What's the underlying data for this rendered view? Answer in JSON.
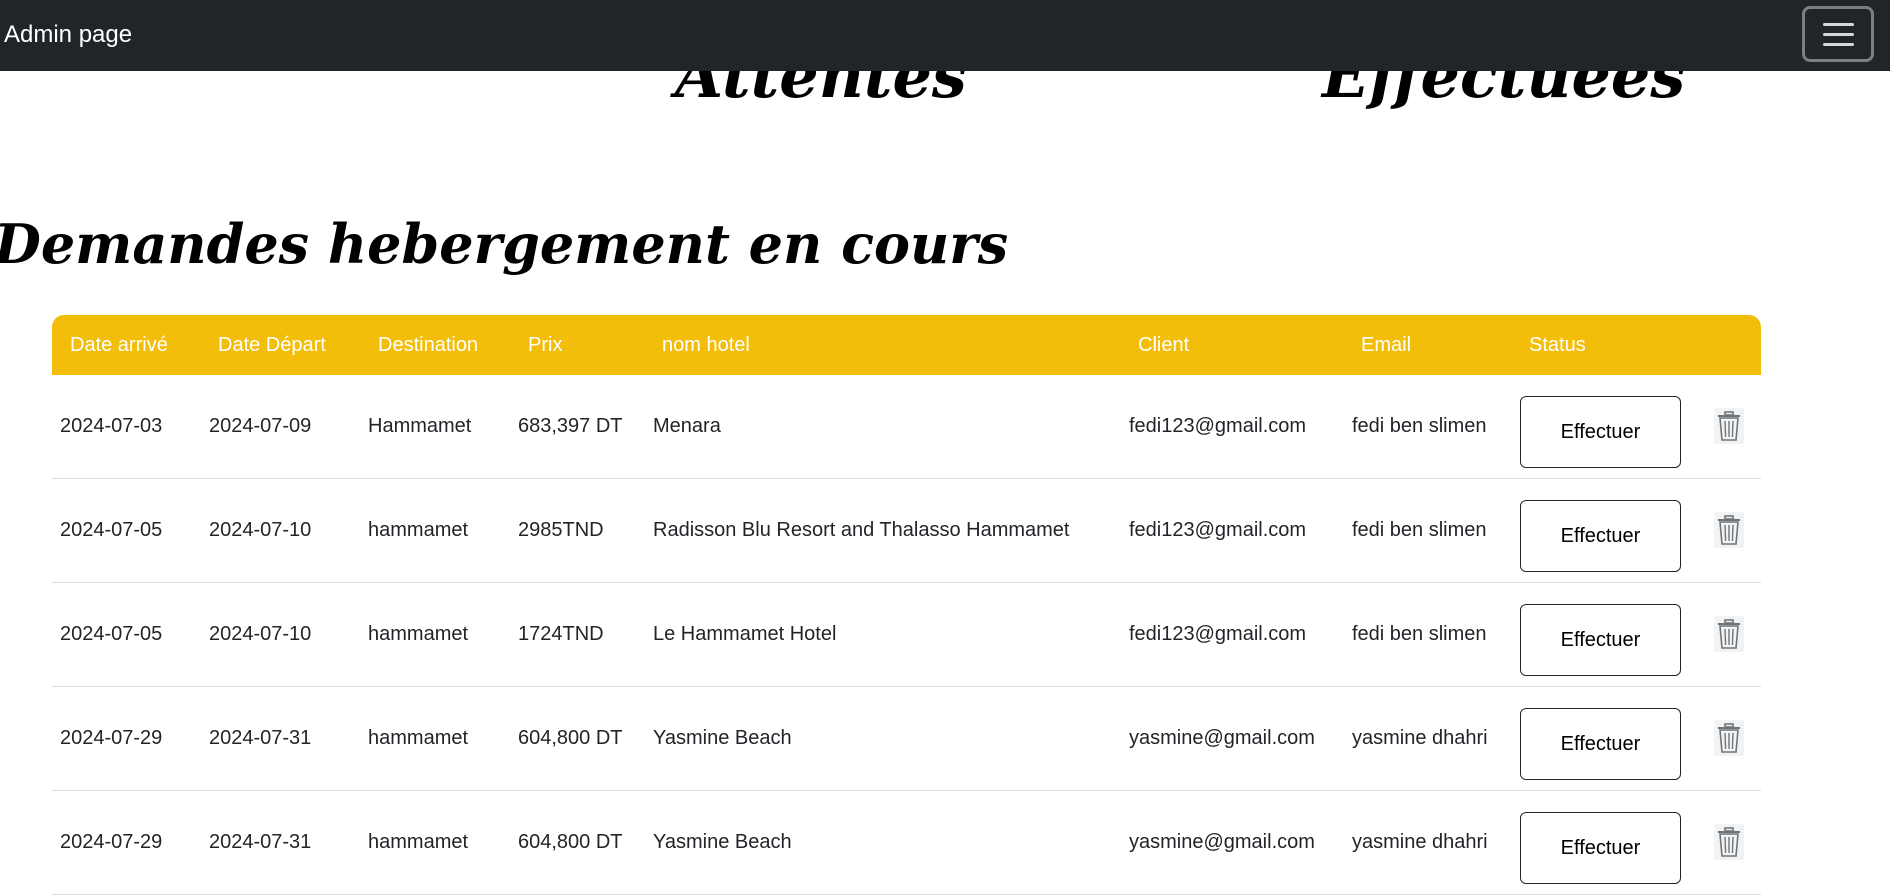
{
  "navbar": {
    "brand": "Admin page",
    "toggle_icon": "hamburger-icon"
  },
  "counters": {
    "attentes_label": "Attentes",
    "effectuees_label": "Effectuées"
  },
  "section": {
    "title": "Demandes hebergement en cours"
  },
  "table": {
    "headers": [
      "Date arrivé",
      "Date Départ",
      "Destination",
      "Prix",
      "nom hotel",
      "Client",
      "Email",
      "Status"
    ],
    "action_label": "Effectuer",
    "delete_icon": "trash-icon",
    "rows": [
      [
        "2024-07-03",
        "2024-07-09",
        "Hammamet",
        "683,397 DT",
        "Menara",
        "fedi123@gmail.com",
        "fedi ben slimen"
      ],
      [
        "2024-07-05",
        "2024-07-10",
        "hammamet",
        "2985TND",
        "Radisson Blu Resort and Thalasso Hammamet",
        "fedi123@gmail.com",
        "fedi ben slimen"
      ],
      [
        "2024-07-05",
        "2024-07-10",
        "hammamet",
        "1724TND",
        "Le Hammamet Hotel",
        "fedi123@gmail.com",
        "fedi ben slimen"
      ],
      [
        "2024-07-29",
        "2024-07-31",
        "hammamet",
        "604,800 DT",
        "Yasmine Beach",
        "yasmine@gmail.com",
        "yasmine dhahri"
      ],
      [
        "2024-07-29",
        "2024-07-31",
        "hammamet",
        "604,800 DT",
        "Yasmine Beach",
        "yasmine@gmail.com",
        "yasmine dhahri"
      ]
    ]
  }
}
